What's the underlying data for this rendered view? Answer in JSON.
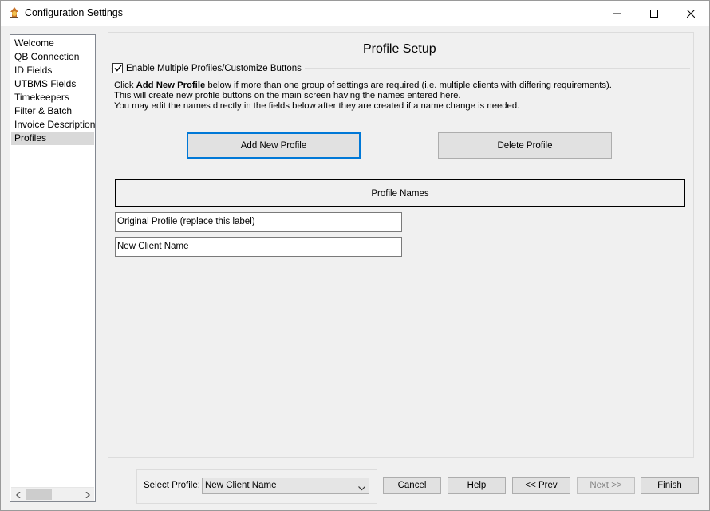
{
  "window": {
    "title": "Configuration Settings",
    "icon": "app-logo-icon",
    "controls": [
      "minimize-icon",
      "maximize-icon",
      "close-icon"
    ]
  },
  "sidebar": {
    "items": [
      {
        "label": "Welcome"
      },
      {
        "label": "QB Connection"
      },
      {
        "label": "ID Fields"
      },
      {
        "label": "UTBMS Fields"
      },
      {
        "label": "Timekeepers"
      },
      {
        "label": "Filter & Batch"
      },
      {
        "label": "Invoice Description"
      },
      {
        "label": "Profiles",
        "selected": true
      }
    ]
  },
  "main": {
    "title": "Profile Setup",
    "enable_checkbox": {
      "label": "Enable Multiple Profiles/Customize Buttons",
      "checked": true
    },
    "description": {
      "line1_prefix": "Click ",
      "line1_bold": "Add New Profile",
      "line1_suffix": " below if more than one group of settings are required (i.e. multiple clients with differing requirements).",
      "line2": "This will create new profile buttons on the main screen having the names entered here.",
      "line3": "You may edit the names directly in the fields below after they are created if a name change is needed."
    },
    "add_button": "Add New Profile",
    "delete_button": "Delete Profile",
    "names_header": "Profile Names",
    "profile_names": [
      "Original Profile (replace this label)",
      "New Client Name"
    ]
  },
  "footer": {
    "select_label": "Select Profile:",
    "selected_profile": "New Client Name",
    "buttons": {
      "cancel": "Cancel",
      "help": "Help",
      "prev": "<< Prev",
      "next": "Next >>",
      "finish": "Finish"
    }
  },
  "colors": {
    "focus": "#0078d7",
    "selection": "#d9d9d9",
    "background": "#f0f0f0"
  }
}
